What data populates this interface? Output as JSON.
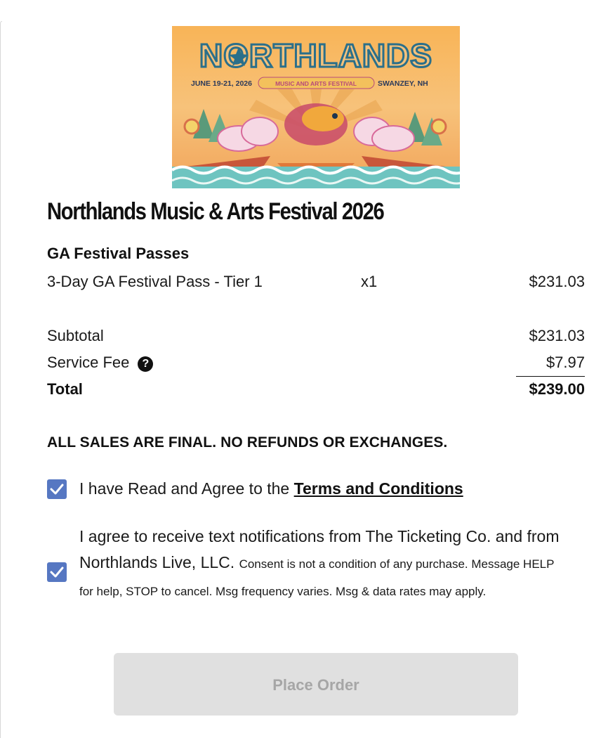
{
  "banner": {
    "logo_text": "NORTHLANDS",
    "dates": "JUNE 19-21, 2026",
    "tagline": "MUSIC AND ARTS FESTIVAL",
    "location": "SWANZEY, NH"
  },
  "event": {
    "title": "Northlands Music & Arts Festival 2026"
  },
  "order": {
    "section_title": "GA Festival Passes",
    "items": [
      {
        "name": "3-Day GA Festival Pass - Tier 1",
        "qty": "x1",
        "price": "$231.03"
      }
    ],
    "subtotal_label": "Subtotal",
    "subtotal_value": "$231.03",
    "fee_label": "Service Fee",
    "fee_help_icon": "question-circle-icon",
    "fee_value": "$7.97",
    "total_label": "Total",
    "total_value": "$239.00"
  },
  "notice": "ALL SALES ARE FINAL. NO REFUNDS OR EXCHANGES.",
  "consents": {
    "terms_prefix": "I have Read and Agree to the ",
    "terms_link": "Terms and Conditions",
    "terms_checked": true,
    "sms_main": "I agree to receive text notifications from The Ticketing Co. and from Northlands Live, LLC.",
    "sms_fine": "Consent is not a condition of any purchase. Message HELP for help, STOP to cancel. Msg frequency varies. Msg & data rates may apply.",
    "sms_checked": true
  },
  "actions": {
    "place_order": "Place Order",
    "place_order_disabled": true
  },
  "colors": {
    "checkbox": "#5677c2",
    "button_disabled_bg": "#e0e0e0",
    "button_disabled_text": "#a6a6a6"
  }
}
